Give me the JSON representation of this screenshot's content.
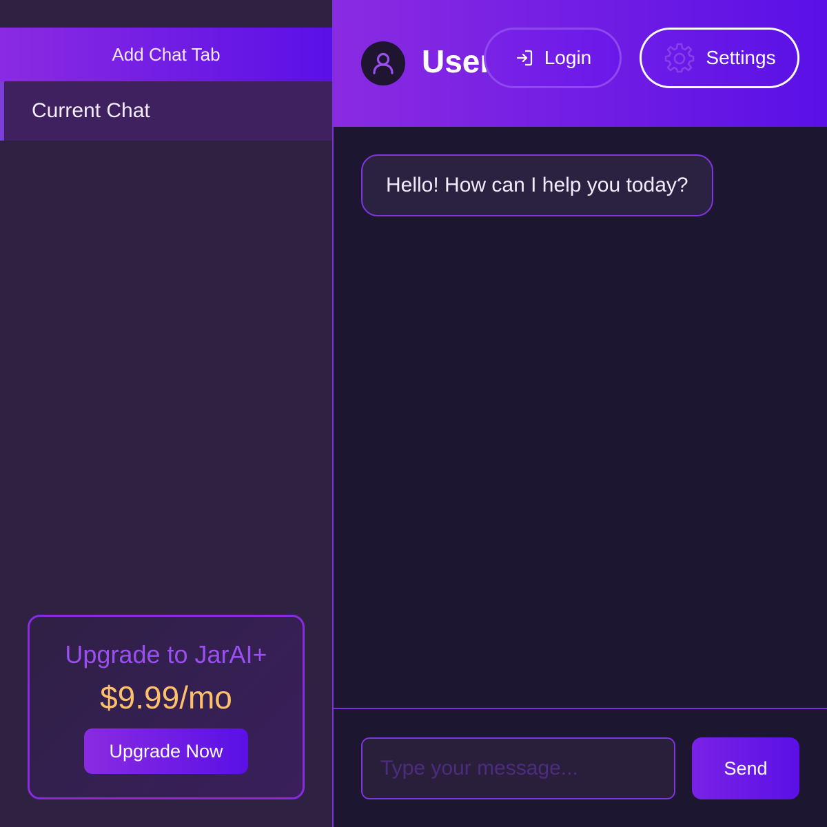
{
  "sidebar": {
    "add_tab_label": "Add Chat Tab",
    "chat_items": [
      {
        "label": "Current Chat",
        "active": true
      }
    ],
    "upgrade": {
      "title": "Upgrade to JarAI+",
      "price": "$9.99/mo",
      "button_label": "Upgrade Now"
    }
  },
  "header": {
    "avatar_icon": "user-icon",
    "username": "User",
    "login_label": "Login",
    "login_icon": "login-icon",
    "settings_label": "Settings",
    "settings_icon": "gear-icon"
  },
  "messages": [
    {
      "role": "assistant",
      "text": "Hello! How can I help you today?"
    }
  ],
  "composer": {
    "placeholder": "Type your message...",
    "send_label": "Send"
  },
  "colors": {
    "accent_start": "#8a2be2",
    "accent_end": "#5a10e6",
    "sidebar_bg": "#2e2142",
    "chat_bg": "#1c1630",
    "price": "#ffc06b"
  }
}
